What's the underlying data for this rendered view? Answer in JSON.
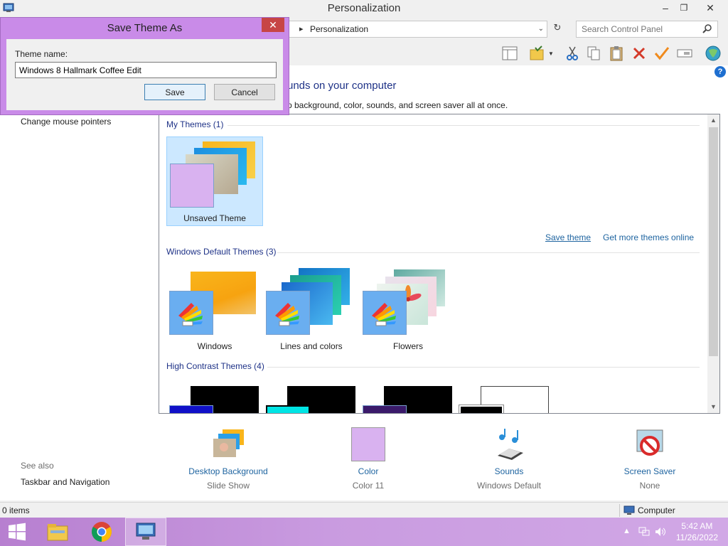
{
  "window": {
    "title": "Personalization"
  },
  "address": {
    "crumb": "Personalization"
  },
  "search": {
    "placeholder": "Search Control Panel"
  },
  "page": {
    "heading_visible": "unds on your computer",
    "subtext_visible": "p background, color, sounds, and screen saver all at once."
  },
  "left_pane": {
    "link_mouse": "Change mouse pointers",
    "see_also": "See also",
    "link_taskbar": "Taskbar and Navigation"
  },
  "theme_groups": {
    "my": {
      "title": "My Themes (1)",
      "items": [
        "Unsaved Theme"
      ]
    },
    "default": {
      "title": "Windows Default Themes (3)",
      "items": [
        "Windows",
        "Lines and colors",
        "Flowers"
      ]
    },
    "contrast": {
      "title": "High Contrast Themes (4)"
    },
    "links": {
      "save": "Save theme",
      "more": "Get more themes online"
    }
  },
  "customizers": [
    {
      "label": "Desktop Background",
      "value": "Slide Show"
    },
    {
      "label": "Color",
      "value": "Color 11"
    },
    {
      "label": "Sounds",
      "value": "Windows Default"
    },
    {
      "label": "Screen Saver",
      "value": "None"
    }
  ],
  "status": {
    "items": "0 items",
    "location": "Computer"
  },
  "clock": {
    "time": "5:42 AM",
    "date": "11/26/2022"
  },
  "dialog": {
    "title": "Save Theme As",
    "label": "Theme name:",
    "value": "Windows 8 Hallmark Coffee Edit",
    "save": "Save",
    "cancel": "Cancel"
  },
  "colors": {
    "accent": "#c98be8",
    "link": "#1e64a0",
    "heading": "#1e3287",
    "selection": "#cce8ff"
  }
}
